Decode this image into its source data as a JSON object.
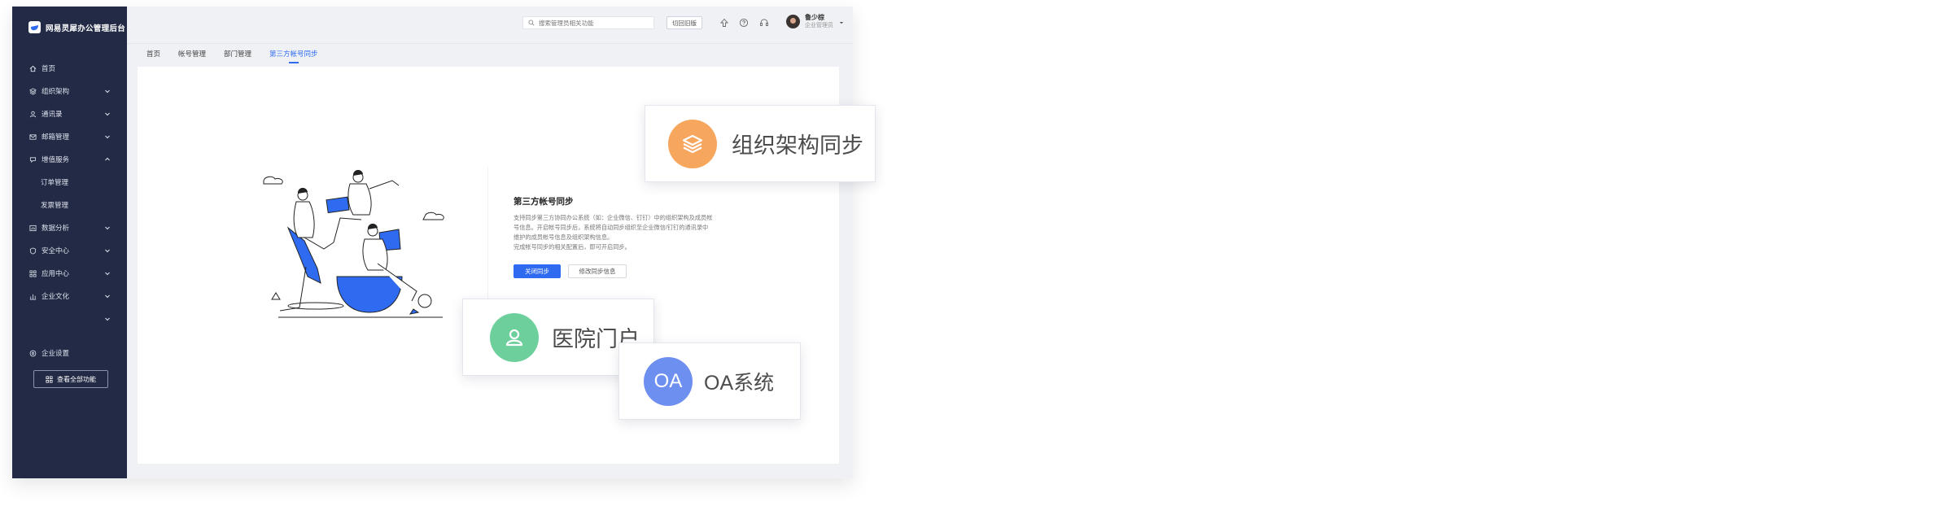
{
  "brand": {
    "name": "网易灵犀办公管理后台"
  },
  "sidebar": {
    "items": [
      {
        "label": "首页",
        "icon": "home-icon",
        "expandable": false
      },
      {
        "label": "组织架构",
        "icon": "org-icon",
        "expandable": true
      },
      {
        "label": "通讯录",
        "icon": "contacts-icon",
        "expandable": true
      },
      {
        "label": "邮箱管理",
        "icon": "mail-icon",
        "expandable": true
      },
      {
        "label": "增值服务",
        "icon": "service-icon",
        "expandable": true,
        "expanded": true
      },
      {
        "label": "订单管理",
        "sub": true
      },
      {
        "label": "发票管理",
        "sub": true
      },
      {
        "label": "数据分析",
        "icon": "chart-icon",
        "expandable": true
      },
      {
        "label": "安全中心",
        "icon": "shield-icon",
        "expandable": true
      },
      {
        "label": "应用中心",
        "icon": "apps-icon",
        "expandable": true
      },
      {
        "label": "企业文化",
        "icon": "culture-icon",
        "expandable": true
      },
      {
        "label": "",
        "icon": "",
        "expandable": true
      },
      {
        "label": "企业设置",
        "icon": "settings-icon",
        "expandable": false
      }
    ],
    "all_functions_label": "查看全部功能"
  },
  "header": {
    "search_placeholder": "搜索管理员相关功能",
    "switch_old_label": "切回旧版",
    "user_name": "鲁少棕",
    "user_role": "企业管理员"
  },
  "tabs": [
    {
      "label": "首页",
      "active": false
    },
    {
      "label": "帐号管理",
      "active": false
    },
    {
      "label": "部门管理",
      "active": false
    },
    {
      "label": "第三方帐号同步",
      "active": true
    }
  ],
  "main": {
    "title": "第三方帐号同步",
    "description_lines": [
      "支持同步第三方协同办公系统（如：企业微信、钉钉）中的组织架构及成员帐",
      "号信息。开启帐号同步后，系统将自动同步组织至企业微信/钉钉的通讯录中",
      "维护的成员帐号信息及组织架构信息。",
      "完成帐号同步的相关配置后，即可开启同步。"
    ],
    "primary_button": "关闭同步",
    "secondary_button": "修改同步信息"
  },
  "float_cards": [
    {
      "label": "组织架构同步",
      "icon": "layers-icon",
      "color": "#f7a65e"
    },
    {
      "label": "医院门户",
      "icon": "user-icon",
      "color": "#6dd09c"
    },
    {
      "label": "OA系统",
      "icon_text": "OA",
      "color": "#6d8ff0"
    }
  ],
  "colors": {
    "sidebar_bg": "#222a45",
    "accent": "#2f6bf0"
  }
}
